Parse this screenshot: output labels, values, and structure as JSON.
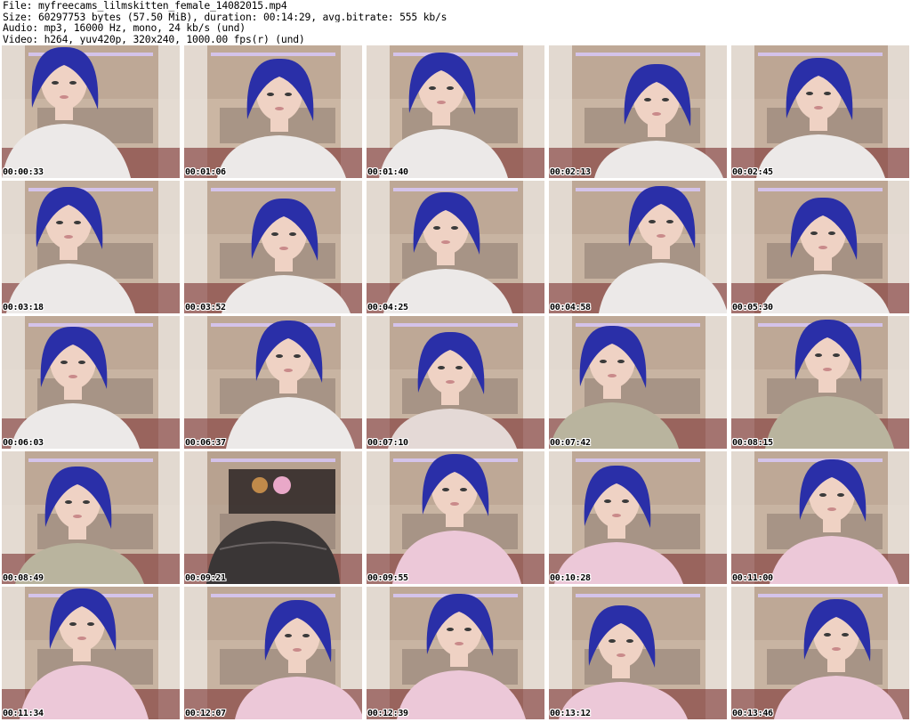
{
  "header": {
    "file_line": "File: myfreecams_lilmskitten_female_14082015.mp4",
    "size_line": "Size: 60297753 bytes (57.50 MiB), duration: 00:14:29, avg.bitrate: 555 kb/s",
    "audio_line": "Audio: mp3, 16000 Hz, mono, 24 kb/s (und)",
    "video_line": "Video: h264, yuv420p, 320x240, 1000.00 fps(r) (und)"
  },
  "thumbnails": [
    {
      "timestamp": "00:00:33",
      "shirt": "#ece9e8",
      "bg": "#c8b4a2"
    },
    {
      "timestamp": "00:01:06",
      "shirt": "#ece9e8",
      "bg": "#cbb6a3"
    },
    {
      "timestamp": "00:01:40",
      "shirt": "#ece9e8",
      "bg": "#cbb6a3"
    },
    {
      "timestamp": "00:02:13",
      "shirt": "#ece9e8",
      "bg": "#c9b5a3"
    },
    {
      "timestamp": "00:02:45",
      "shirt": "#ece9e8",
      "bg": "#c6b09e"
    },
    {
      "timestamp": "00:03:18",
      "shirt": "#ece9e8",
      "bg": "#c8b4a2"
    },
    {
      "timestamp": "00:03:52",
      "shirt": "#ece9e8",
      "bg": "#c8b4a2"
    },
    {
      "timestamp": "00:04:25",
      "shirt": "#ece9e8",
      "bg": "#c8b4a2"
    },
    {
      "timestamp": "00:04:58",
      "shirt": "#ece9e8",
      "bg": "#c8b4a2"
    },
    {
      "timestamp": "00:05:30",
      "shirt": "#ece9e8",
      "bg": "#c6b09e"
    },
    {
      "timestamp": "00:06:03",
      "shirt": "#ece9e8",
      "bg": "#c8b4a2"
    },
    {
      "timestamp": "00:06:37",
      "shirt": "#ece9e8",
      "bg": "#c8b4a2"
    },
    {
      "timestamp": "00:07:10",
      "shirt": "#e4d9d6",
      "bg": "#c8b4a2"
    },
    {
      "timestamp": "00:07:42",
      "shirt": "#b9b49e",
      "bg": "#c8b4a2"
    },
    {
      "timestamp": "00:08:15",
      "shirt": "#b9b49e",
      "bg": "#c8b4a2"
    },
    {
      "timestamp": "00:08:49",
      "shirt": "#b9b49e",
      "bg": "#c8b4a2"
    },
    {
      "timestamp": "00:09:21",
      "shirt": "#3a3636",
      "bg": "#b9a594"
    },
    {
      "timestamp": "00:09:55",
      "shirt": "#ecc8d8",
      "bg": "#c8b4a2"
    },
    {
      "timestamp": "00:10:28",
      "shirt": "#ecc8d8",
      "bg": "#c8b4a2"
    },
    {
      "timestamp": "00:11:00",
      "shirt": "#ecc8d8",
      "bg": "#c8b4a2"
    },
    {
      "timestamp": "00:11:34",
      "shirt": "#ecc8d8",
      "bg": "#c8b4a2"
    },
    {
      "timestamp": "00:12:07",
      "shirt": "#ecc8d8",
      "bg": "#c8b4a2"
    },
    {
      "timestamp": "00:12:39",
      "shirt": "#ecc8d8",
      "bg": "#c8b4a2"
    },
    {
      "timestamp": "00:13:12",
      "shirt": "#ecc8d8",
      "bg": "#c8b4a2"
    },
    {
      "timestamp": "00:13:46",
      "shirt": "#ecc8d8",
      "bg": "#c8b4a2"
    }
  ],
  "colors": {
    "hair": "#2a2fa8",
    "skin": "#efd2c4",
    "chair": "#5a2a2a"
  }
}
